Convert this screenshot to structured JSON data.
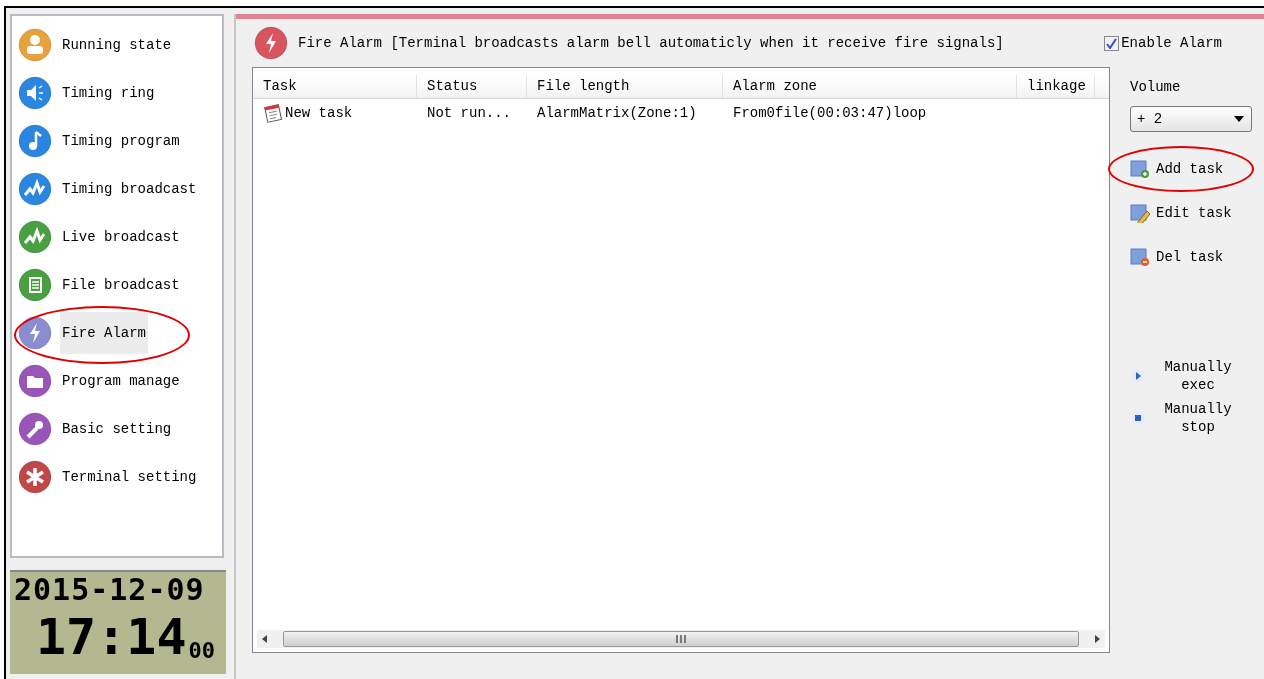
{
  "sidebar": {
    "items": [
      {
        "label": "Running state",
        "selected": false,
        "circled": false
      },
      {
        "label": "Timing ring",
        "selected": false,
        "circled": false
      },
      {
        "label": "Timing program",
        "selected": false,
        "circled": false
      },
      {
        "label": "Timing broadcast",
        "selected": false,
        "circled": false
      },
      {
        "label": "Live broadcast",
        "selected": false,
        "circled": false
      },
      {
        "label": "File broadcast",
        "selected": false,
        "circled": false
      },
      {
        "label": "Fire Alarm",
        "selected": true,
        "circled": true
      },
      {
        "label": "Program manage",
        "selected": false,
        "circled": false
      },
      {
        "label": "Basic setting",
        "selected": false,
        "circled": false
      },
      {
        "label": "Terminal setting",
        "selected": false,
        "circled": false
      }
    ]
  },
  "clock": {
    "date": "2015-12-09",
    "time": "17:14",
    "seconds": "00"
  },
  "header": {
    "title": "Fire Alarm [Terminal broadcasts alarm bell automaticly when it receive fire signals]",
    "enable_alarm": {
      "label": "Enable Alarm",
      "checked": true
    }
  },
  "table": {
    "columns": [
      "Task",
      "Status",
      "File length",
      "Alarm zone",
      "linkage"
    ],
    "rows": [
      [
        "New task",
        "Not run...",
        "AlarmMatrix(Zone:1)",
        "From0file(00:03:47)loop",
        ""
      ]
    ]
  },
  "volume": {
    "label": "Volume",
    "value": "+ 2"
  },
  "actions": [
    {
      "label": "Add task",
      "circled": true
    },
    {
      "label": "Edit task",
      "circled": false
    },
    {
      "label": "Del task",
      "circled": false
    }
  ],
  "manual": [
    {
      "label": "Manually exec"
    },
    {
      "label": "Manually stop"
    }
  ]
}
